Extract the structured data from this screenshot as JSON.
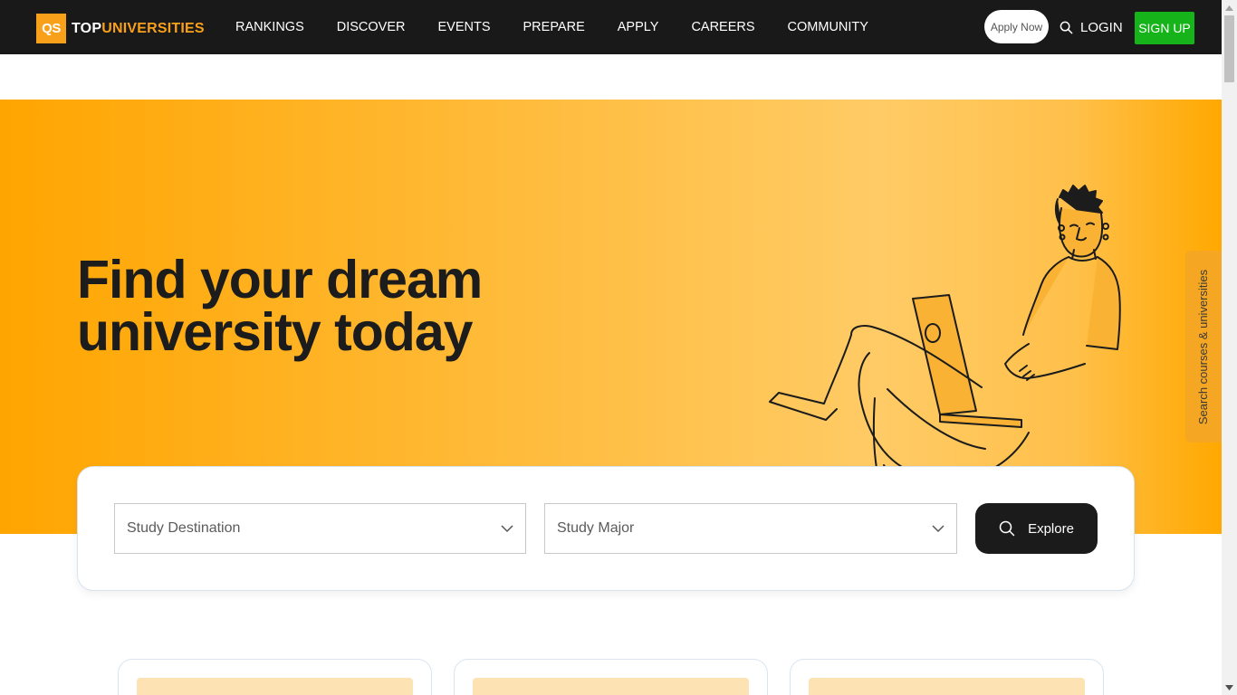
{
  "nav": {
    "logo_badge": "QS",
    "logo_text_1": "TOP",
    "logo_text_2": "UNIVERSITIES",
    "menu": [
      "RANKINGS",
      "DISCOVER",
      "EVENTS",
      "PREPARE",
      "APPLY",
      "CAREERS",
      "COMMUNITY"
    ],
    "apply_now": "Apply Now",
    "login": "LOGIN",
    "signup": "SIGN UP"
  },
  "hero": {
    "title": "Find your dream university today",
    "side_tab": "Search courses & universities"
  },
  "search": {
    "destination_placeholder": "Study Destination",
    "major_placeholder": "Study Major",
    "explore_label": "Explore"
  },
  "colors": {
    "brand_orange": "#f9a01b",
    "nav_bg": "#191919",
    "signup_green": "#17b31b",
    "explore_bg": "#1b1b1b"
  },
  "icons": [
    "search-icon",
    "chevron-down-icon",
    "scroll-up-arrow-icon",
    "scroll-down-arrow-icon"
  ]
}
